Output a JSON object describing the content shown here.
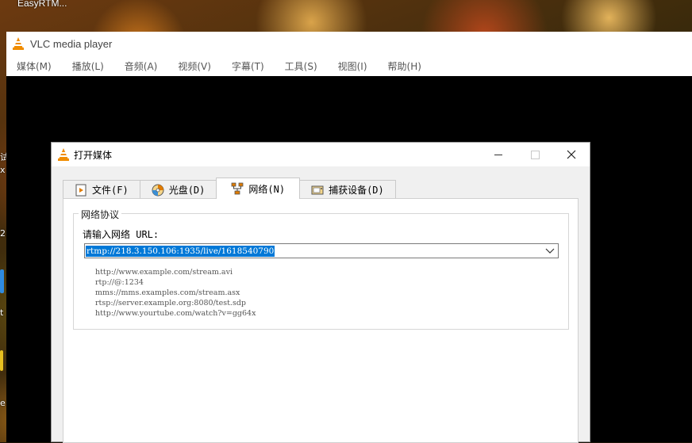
{
  "desktop": {
    "icon_label": "EasyRTM...",
    "edge_glyphs": [
      "试",
      "x",
      "2.",
      "t",
      "e"
    ]
  },
  "vlc": {
    "title": "VLC media player",
    "menu": [
      "媒体(M)",
      "播放(L)",
      "音频(A)",
      "视频(V)",
      "字幕(T)",
      "工具(S)",
      "视图(I)",
      "帮助(H)"
    ]
  },
  "dialog": {
    "title": "打开媒体",
    "tabs": [
      {
        "label": "文件(F)",
        "icon": "file-play-icon",
        "active": false
      },
      {
        "label": "光盘(D)",
        "icon": "disc-icon",
        "active": false
      },
      {
        "label": "网络(N)",
        "icon": "network-icon",
        "active": true
      },
      {
        "label": "捕获设备(D)",
        "icon": "capture-device-icon",
        "active": false
      }
    ],
    "network": {
      "group_title": "网络协议",
      "url_label": "请输入网络 URL:",
      "url_value": "rtmp://218.3.150.106:1935/live/1618540790",
      "examples": [
        "http://www.example.com/stream.avi",
        "rtp://@:1234",
        "mms://mms.examples.com/stream.asx",
        "rtsp://server.example.org:8080/test.sdp",
        "http://www.yourtube.com/watch?v=gg64x"
      ]
    }
  },
  "colors": {
    "selection": "#0078d7",
    "vlc_orange": "#f08c00"
  }
}
